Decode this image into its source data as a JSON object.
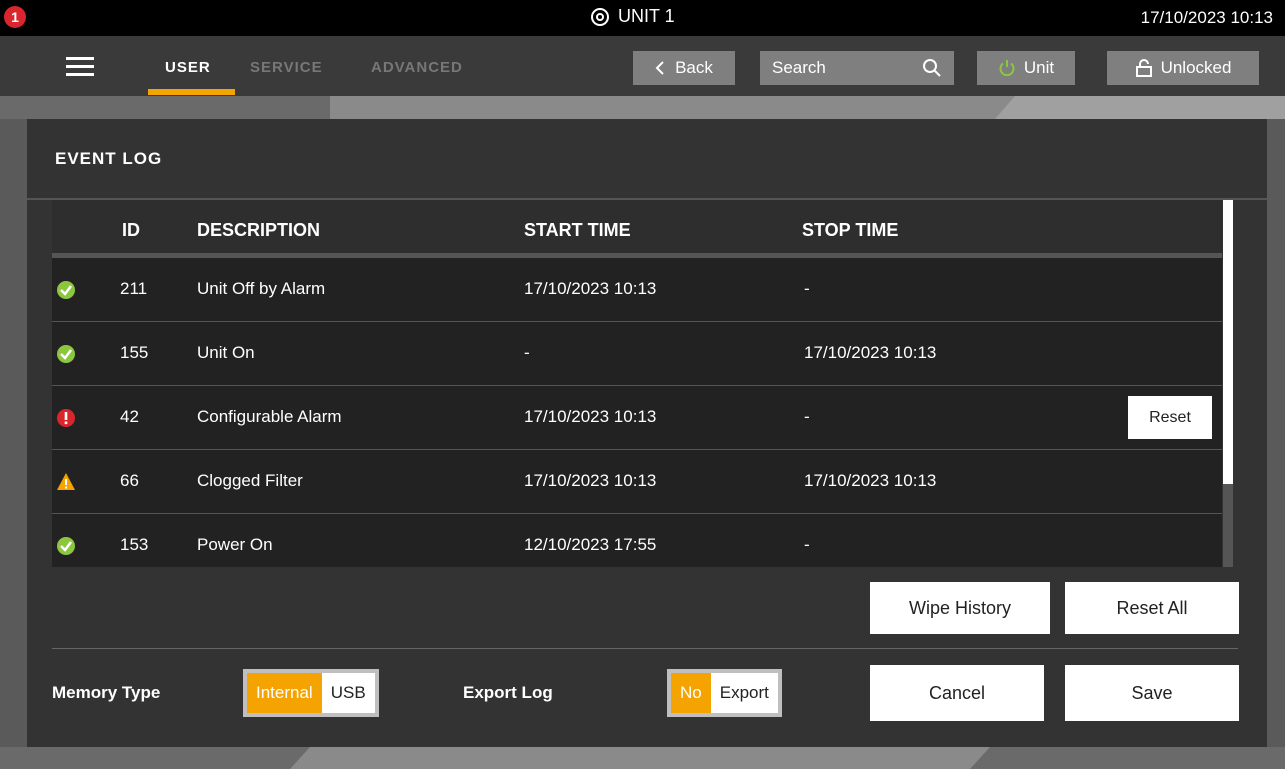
{
  "topbar": {
    "alarm_count": "1",
    "unit_title": "UNIT 1",
    "datetime": "17/10/2023 10:13"
  },
  "nav": {
    "tabs": [
      {
        "label": "USER",
        "active": true
      },
      {
        "label": "SERVICE",
        "active": false
      },
      {
        "label": "ADVANCED",
        "active": false
      }
    ],
    "back_label": "Back",
    "search_label": "Search",
    "unit_label": "Unit",
    "lock_label": "Unlocked"
  },
  "panel": {
    "title": "EVENT LOG"
  },
  "table": {
    "headers": {
      "id": "ID",
      "description": "DESCRIPTION",
      "start": "START TIME",
      "stop": "STOP TIME"
    },
    "rows": [
      {
        "status": "ok",
        "id": "211",
        "description": "Unit Off by Alarm",
        "start": "17/10/2023 10:13",
        "stop": "-",
        "action": ""
      },
      {
        "status": "ok",
        "id": "155",
        "description": "Unit On",
        "start": "-",
        "stop": "17/10/2023 10:13",
        "action": ""
      },
      {
        "status": "alarm",
        "id": "42",
        "description": "Configurable Alarm",
        "start": "17/10/2023 10:13",
        "stop": "-",
        "action": "Reset"
      },
      {
        "status": "warning",
        "id": "66",
        "description": "Clogged Filter",
        "start": "17/10/2023 10:13",
        "stop": "17/10/2023 10:13",
        "action": ""
      },
      {
        "status": "ok",
        "id": "153",
        "description": "Power On",
        "start": "12/10/2023 17:55",
        "stop": "-",
        "action": ""
      }
    ]
  },
  "actions": {
    "wipe_label": "Wipe History",
    "reset_all_label": "Reset All",
    "cancel_label": "Cancel",
    "save_label": "Save"
  },
  "memory": {
    "label": "Memory Type",
    "options": [
      "Internal",
      "USB"
    ],
    "selected": "Internal"
  },
  "export": {
    "label": "Export Log",
    "options": [
      "No",
      "Export"
    ],
    "selected": "No"
  },
  "colors": {
    "accent": "#f5a300",
    "ok": "#8cc63f",
    "alarm": "#d9262e",
    "warning": "#f5a300"
  }
}
